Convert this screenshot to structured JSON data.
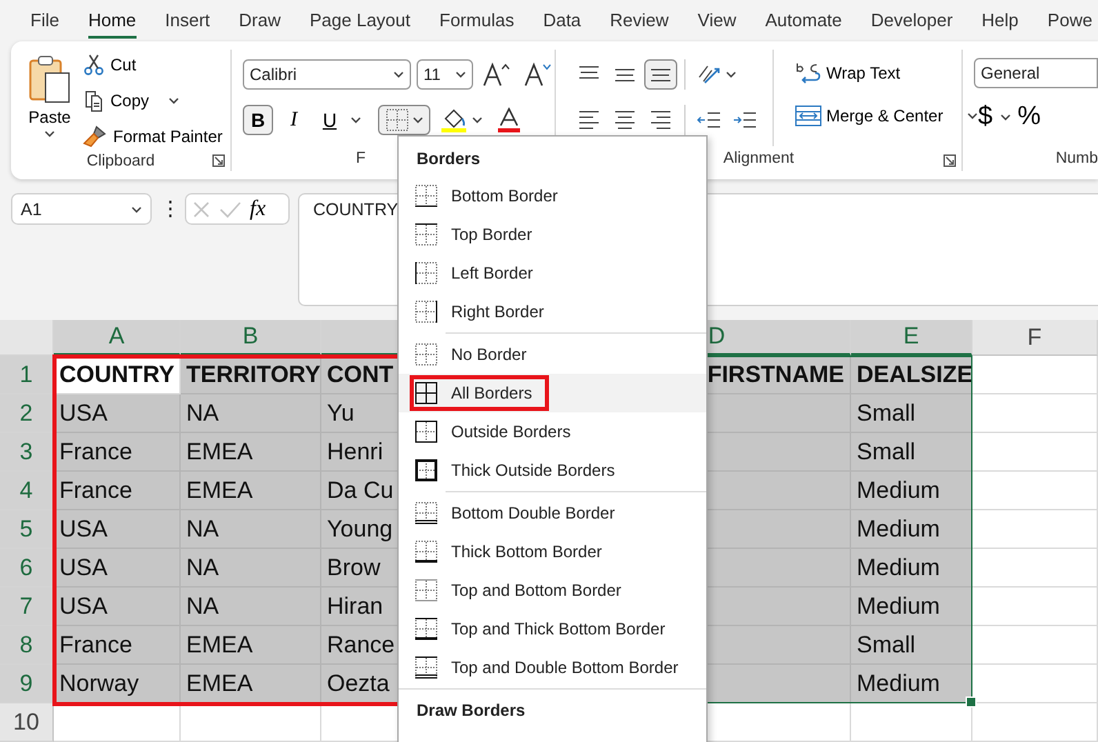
{
  "tabs": [
    {
      "label": "File",
      "selected": false
    },
    {
      "label": "Home",
      "selected": true
    },
    {
      "label": "Insert",
      "selected": false
    },
    {
      "label": "Draw",
      "selected": false
    },
    {
      "label": "Page Layout",
      "selected": false
    },
    {
      "label": "Formulas",
      "selected": false
    },
    {
      "label": "Data",
      "selected": false
    },
    {
      "label": "Review",
      "selected": false
    },
    {
      "label": "View",
      "selected": false
    },
    {
      "label": "Automate",
      "selected": false
    },
    {
      "label": "Developer",
      "selected": false
    },
    {
      "label": "Help",
      "selected": false
    },
    {
      "label": "Powe",
      "selected": false
    }
  ],
  "clipboard": {
    "paste": "Paste",
    "cut": "Cut",
    "copy": "Copy",
    "format_painter": "Format Painter",
    "label": "Clipboard"
  },
  "font": {
    "name": "Calibri",
    "size": "11",
    "bold": "B",
    "italic": "I",
    "underline": "U",
    "borders_open": true,
    "label": "F"
  },
  "alignment": {
    "vertical": [
      {
        "kind": "top",
        "selected": false
      },
      {
        "kind": "middle",
        "selected": false
      },
      {
        "kind": "bottom",
        "selected": true
      }
    ],
    "wrap_text": "Wrap Text",
    "merge": "Merge & Center",
    "label": "Alignment"
  },
  "number": {
    "format": "General",
    "currency": "$",
    "percent": "%",
    "label": "Numb"
  },
  "formula_bar": {
    "name_box": "A1",
    "more": "⋮",
    "fx": "fx",
    "content": "COUNTRY"
  },
  "sheet": {
    "columns": [
      {
        "letter": "A",
        "selected": true,
        "annotated": true
      },
      {
        "letter": "B",
        "selected": true,
        "annotated": true
      },
      {
        "selected": true,
        "annotated": true
      },
      {
        "letter": "D",
        "selected": true,
        "annotated": false
      },
      {
        "letter": "E",
        "selected": true,
        "annotated": false
      },
      {
        "letter": "F",
        "selected": false,
        "annotated": false
      }
    ],
    "rows": [
      {
        "number": "1",
        "selected": true,
        "header": true,
        "cells": [
          "COUNTRY",
          "TERRITORY",
          "CONT",
          "FIRSTNAME",
          "DEALSIZE",
          null
        ]
      },
      {
        "number": "2",
        "selected": true,
        "header": false,
        "cells": [
          "USA",
          "NA",
          "Yu",
          null,
          "Small",
          null
        ]
      },
      {
        "number": "3",
        "selected": true,
        "header": false,
        "cells": [
          "France",
          "EMEA",
          "Henri",
          null,
          "Small",
          null
        ]
      },
      {
        "number": "4",
        "selected": true,
        "header": false,
        "cells": [
          "France",
          "EMEA",
          "Da Cu",
          null,
          "Medium",
          null
        ]
      },
      {
        "number": "5",
        "selected": true,
        "header": false,
        "cells": [
          "USA",
          "NA",
          "Young",
          null,
          "Medium",
          null
        ]
      },
      {
        "number": "6",
        "selected": true,
        "header": false,
        "cells": [
          "USA",
          "NA",
          "Brow",
          null,
          "Medium",
          null
        ]
      },
      {
        "number": "7",
        "selected": true,
        "header": false,
        "cells": [
          "USA",
          "NA",
          "Hiran",
          null,
          "Medium",
          null
        ]
      },
      {
        "number": "8",
        "selected": true,
        "header": false,
        "cells": [
          "France",
          "EMEA",
          "Rance",
          null,
          "Small",
          null
        ]
      },
      {
        "number": "9",
        "selected": true,
        "header": false,
        "cells": [
          "Norway",
          "EMEA",
          "Oezta",
          null,
          "Medium",
          null
        ]
      },
      {
        "number": "10",
        "selected": false,
        "header": false,
        "cells": [
          null,
          null,
          null,
          null,
          null,
          null
        ]
      }
    ]
  },
  "borders_menu": {
    "title": "Borders",
    "sections": [
      {
        "items": [
          {
            "label": "Bottom Border",
            "kind": "bottom",
            "highlighted": false,
            "annotated": false
          },
          {
            "label": "Top Border",
            "kind": "top",
            "highlighted": false,
            "annotated": false
          },
          {
            "label": "Left Border",
            "kind": "left",
            "highlighted": false,
            "annotated": false
          },
          {
            "label": "Right Border",
            "kind": "right",
            "highlighted": false,
            "annotated": false
          }
        ]
      },
      {
        "items": [
          {
            "label": "No Border",
            "kind": "none",
            "highlighted": false,
            "annotated": false
          },
          {
            "label": "All Borders",
            "kind": "all",
            "highlighted": true,
            "annotated": true
          },
          {
            "label": "Outside Borders",
            "kind": "outside",
            "highlighted": false,
            "annotated": false
          },
          {
            "label": "Thick Outside Borders",
            "kind": "thick_outside",
            "highlighted": false,
            "annotated": false
          }
        ]
      },
      {
        "items": [
          {
            "label": "Bottom Double Border",
            "kind": "bottom_double",
            "highlighted": false,
            "annotated": false
          },
          {
            "label": "Thick Bottom Border",
            "kind": "thick_bottom",
            "highlighted": false,
            "annotated": false
          },
          {
            "label": "Top and Bottom Border",
            "kind": "top_bottom",
            "highlighted": false,
            "annotated": false
          },
          {
            "label": "Top and Thick Bottom Border",
            "kind": "top_thick_bottom",
            "highlighted": false,
            "annotated": false
          },
          {
            "label": "Top and Double Bottom Border",
            "kind": "top_double_bottom",
            "highlighted": false,
            "annotated": false
          }
        ]
      }
    ],
    "footer": "Draw Borders"
  }
}
